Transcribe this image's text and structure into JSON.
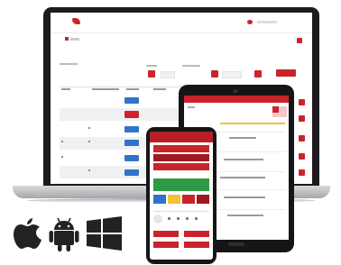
{
  "devices": {
    "laptop": "laptop",
    "tablet": "tablet",
    "phone": "phone"
  },
  "platforms": [
    {
      "name": "apple-icon"
    },
    {
      "name": "android-icon"
    },
    {
      "name": "windows-icon"
    }
  ],
  "colors": {
    "brand_red": "#c9242b",
    "accent_blue": "#2f74c9",
    "accent_green": "#2f9a46",
    "accent_yellow": "#f2c232",
    "device_black": "#151517",
    "icon_black": "#222222"
  }
}
